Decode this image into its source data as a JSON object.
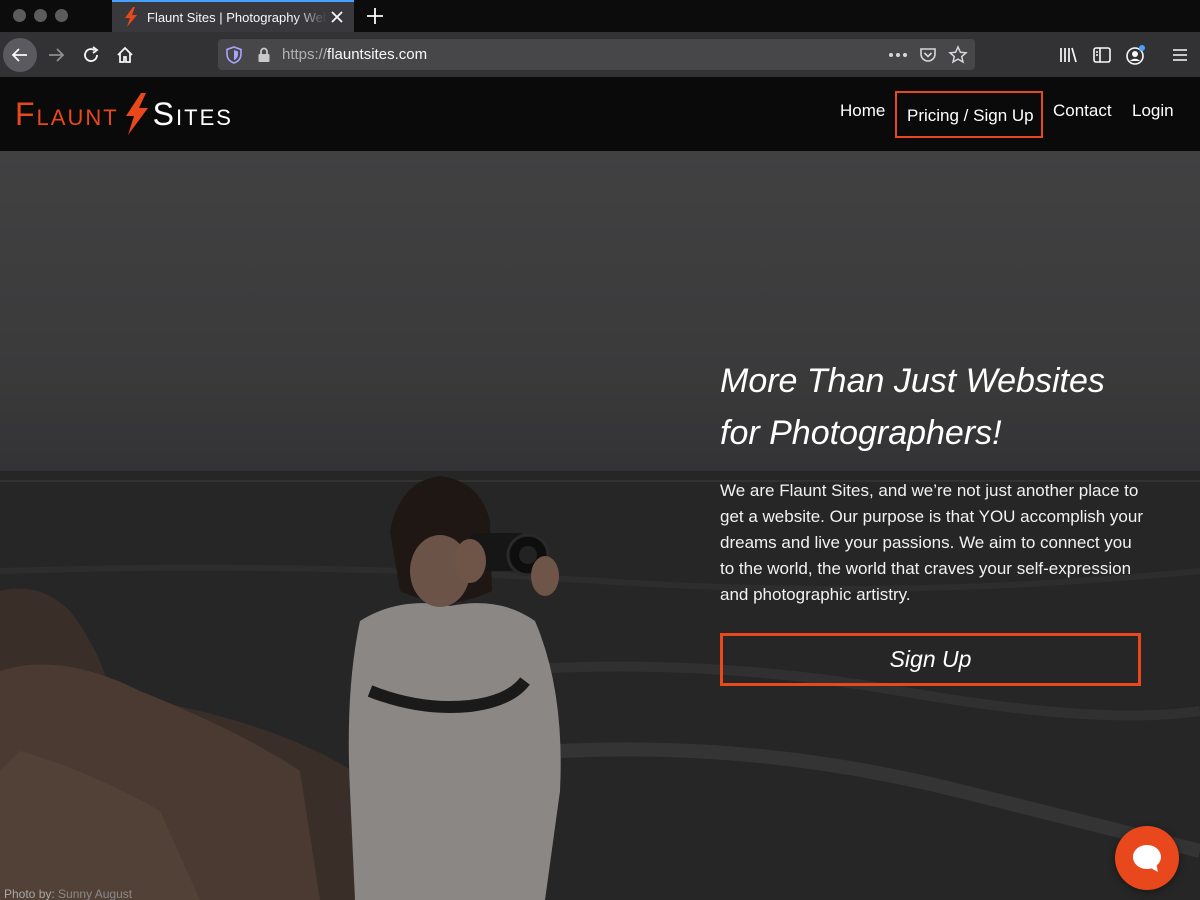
{
  "browser": {
    "tab_title": "Flaunt Sites | Photography Website",
    "url_scheme": "https://",
    "url_host": "flauntsites.com",
    "icons": [
      "back-icon",
      "forward-icon",
      "reload-icon",
      "home-icon",
      "shield-icon",
      "lock-icon",
      "more-icon",
      "pocket-icon",
      "star-icon",
      "library-icon",
      "sidebar-icon",
      "account-icon",
      "hamburger-icon"
    ]
  },
  "site": {
    "logo_word1": "Flaunt",
    "logo_word2": "Sites",
    "nav": {
      "home": "Home",
      "pricing": "Pricing / Sign Up",
      "contact": "Contact",
      "login": "Login"
    },
    "hero": {
      "title_line1": "More Than Just Websites",
      "title_line2": "for Photographers!",
      "body": "We are Flaunt Sites, and we’re not just another place to get a website. Our purpose is that YOU accomplish your dreams and live your passions. We aim to connect you to the world, the world that craves your self-expression and photographic artistry.",
      "cta": "Sign Up",
      "credit_prefix": "Photo by: ",
      "credit_name": "Sunny August"
    }
  },
  "colors": {
    "accent": "#e8481c",
    "header_bg": "#0a0a0a",
    "browser_toolbar": "#323234"
  }
}
